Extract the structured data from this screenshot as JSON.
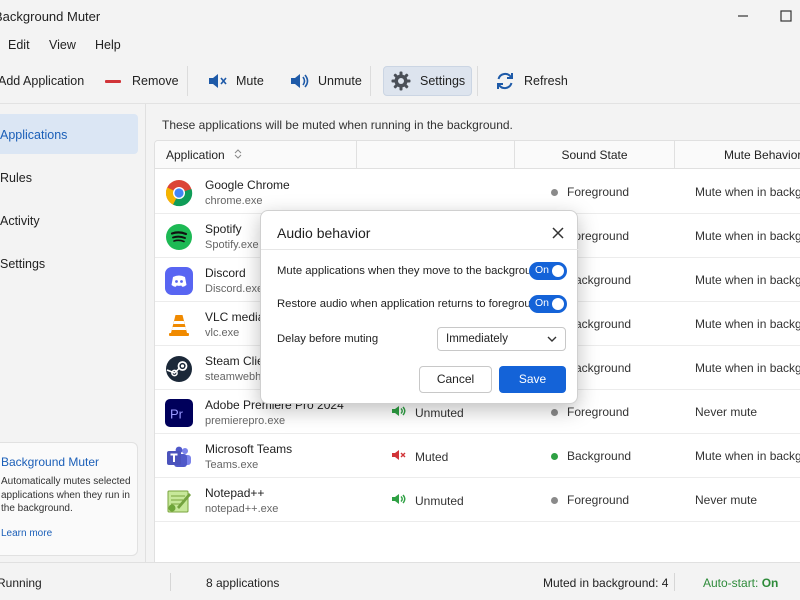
{
  "window": {
    "title": "Background Muter"
  },
  "menu": [
    "Edit",
    "View",
    "Help"
  ],
  "toolbar": {
    "add_label": "Add Application",
    "remove_label": "Remove",
    "mute_label": "Mute",
    "unmute_label": "Unmute",
    "settings_label": "Settings",
    "refresh_label": "Refresh"
  },
  "sidebar": {
    "items": [
      {
        "label": "Applications",
        "active": true
      },
      {
        "label": "Rules"
      },
      {
        "label": "Activity"
      },
      {
        "label": "Settings"
      }
    ],
    "about": {
      "title": "Background Muter",
      "description": "Automatically mutes selected applications when they run in the background.",
      "link": "Learn more"
    }
  },
  "main": {
    "info": "These applications will be muted when running in the background.",
    "columns": {
      "application": "Application",
      "sound_state": "Sound State",
      "mute_behavior": "Mute Behavior"
    },
    "rows": [
      {
        "name": "Google Chrome",
        "exe": "chrome.exe",
        "icon": "chrome-icon",
        "audio": "",
        "state": "Foreground",
        "state_color": "#8a8a8a",
        "behavior": "Mute when in background"
      },
      {
        "name": "Spotify",
        "exe": "Spotify.exe",
        "icon": "spotify-icon",
        "audio": "",
        "state": "Foreground",
        "state_color": "#8a8a8a",
        "behavior": "Mute when in background"
      },
      {
        "name": "Discord",
        "exe": "Discord.exe",
        "icon": "discord-icon",
        "audio": "",
        "state": "Background",
        "state_color": "#8a8a8a",
        "behavior": "Mute when in background"
      },
      {
        "name": "VLC media player",
        "exe": "vlc.exe",
        "icon": "vlc-icon",
        "audio": "",
        "state": "Background",
        "state_color": "#8a8a8a",
        "behavior": "Mute when in background"
      },
      {
        "name": "Steam Client",
        "exe": "steamwebhelper.exe",
        "icon": "steam-icon",
        "audio": "",
        "state": "Background",
        "state_color": "#8a8a8a",
        "behavior": "Mute when in background"
      },
      {
        "name": "Adobe Premiere Pro 2024",
        "exe": "premierepro.exe",
        "icon": "premiere-icon",
        "audio": "Unmuted",
        "audio_state": "unmuted",
        "state": "Foreground",
        "state_color": "#8a8a8a",
        "behavior": "Never mute"
      },
      {
        "name": "Microsoft Teams",
        "exe": "Teams.exe",
        "icon": "teams-icon",
        "audio": "Muted",
        "audio_state": "muted",
        "state": "Background",
        "state_color": "#2ea043",
        "behavior": "Mute when in background"
      },
      {
        "name": "Notepad++",
        "exe": "notepad++.exe",
        "icon": "notepadpp-icon",
        "audio": "Unmuted",
        "audio_state": "unmuted",
        "state": "Foreground",
        "state_color": "#8a8a8a",
        "behavior": "Never mute"
      }
    ]
  },
  "dialog": {
    "title": "Audio behavior",
    "option1": "Mute applications when they move to the background",
    "option1_toggle": "On",
    "option2": "Restore audio when application returns to foreground",
    "option2_toggle": "On",
    "delay_label": "Delay before muting",
    "delay_value": "Immediately",
    "cancel_label": "Cancel",
    "save_label": "Save"
  },
  "status": {
    "running": "Running",
    "count": "8 applications",
    "muted_bg": "Muted in background:  4",
    "autostart_label": "Auto-start:",
    "autostart_value": "On"
  },
  "colors": {
    "accent": "#1463d8",
    "link": "#1b5fb8",
    "muted_red": "#d13438",
    "unmuted_green": "#2ea043"
  }
}
